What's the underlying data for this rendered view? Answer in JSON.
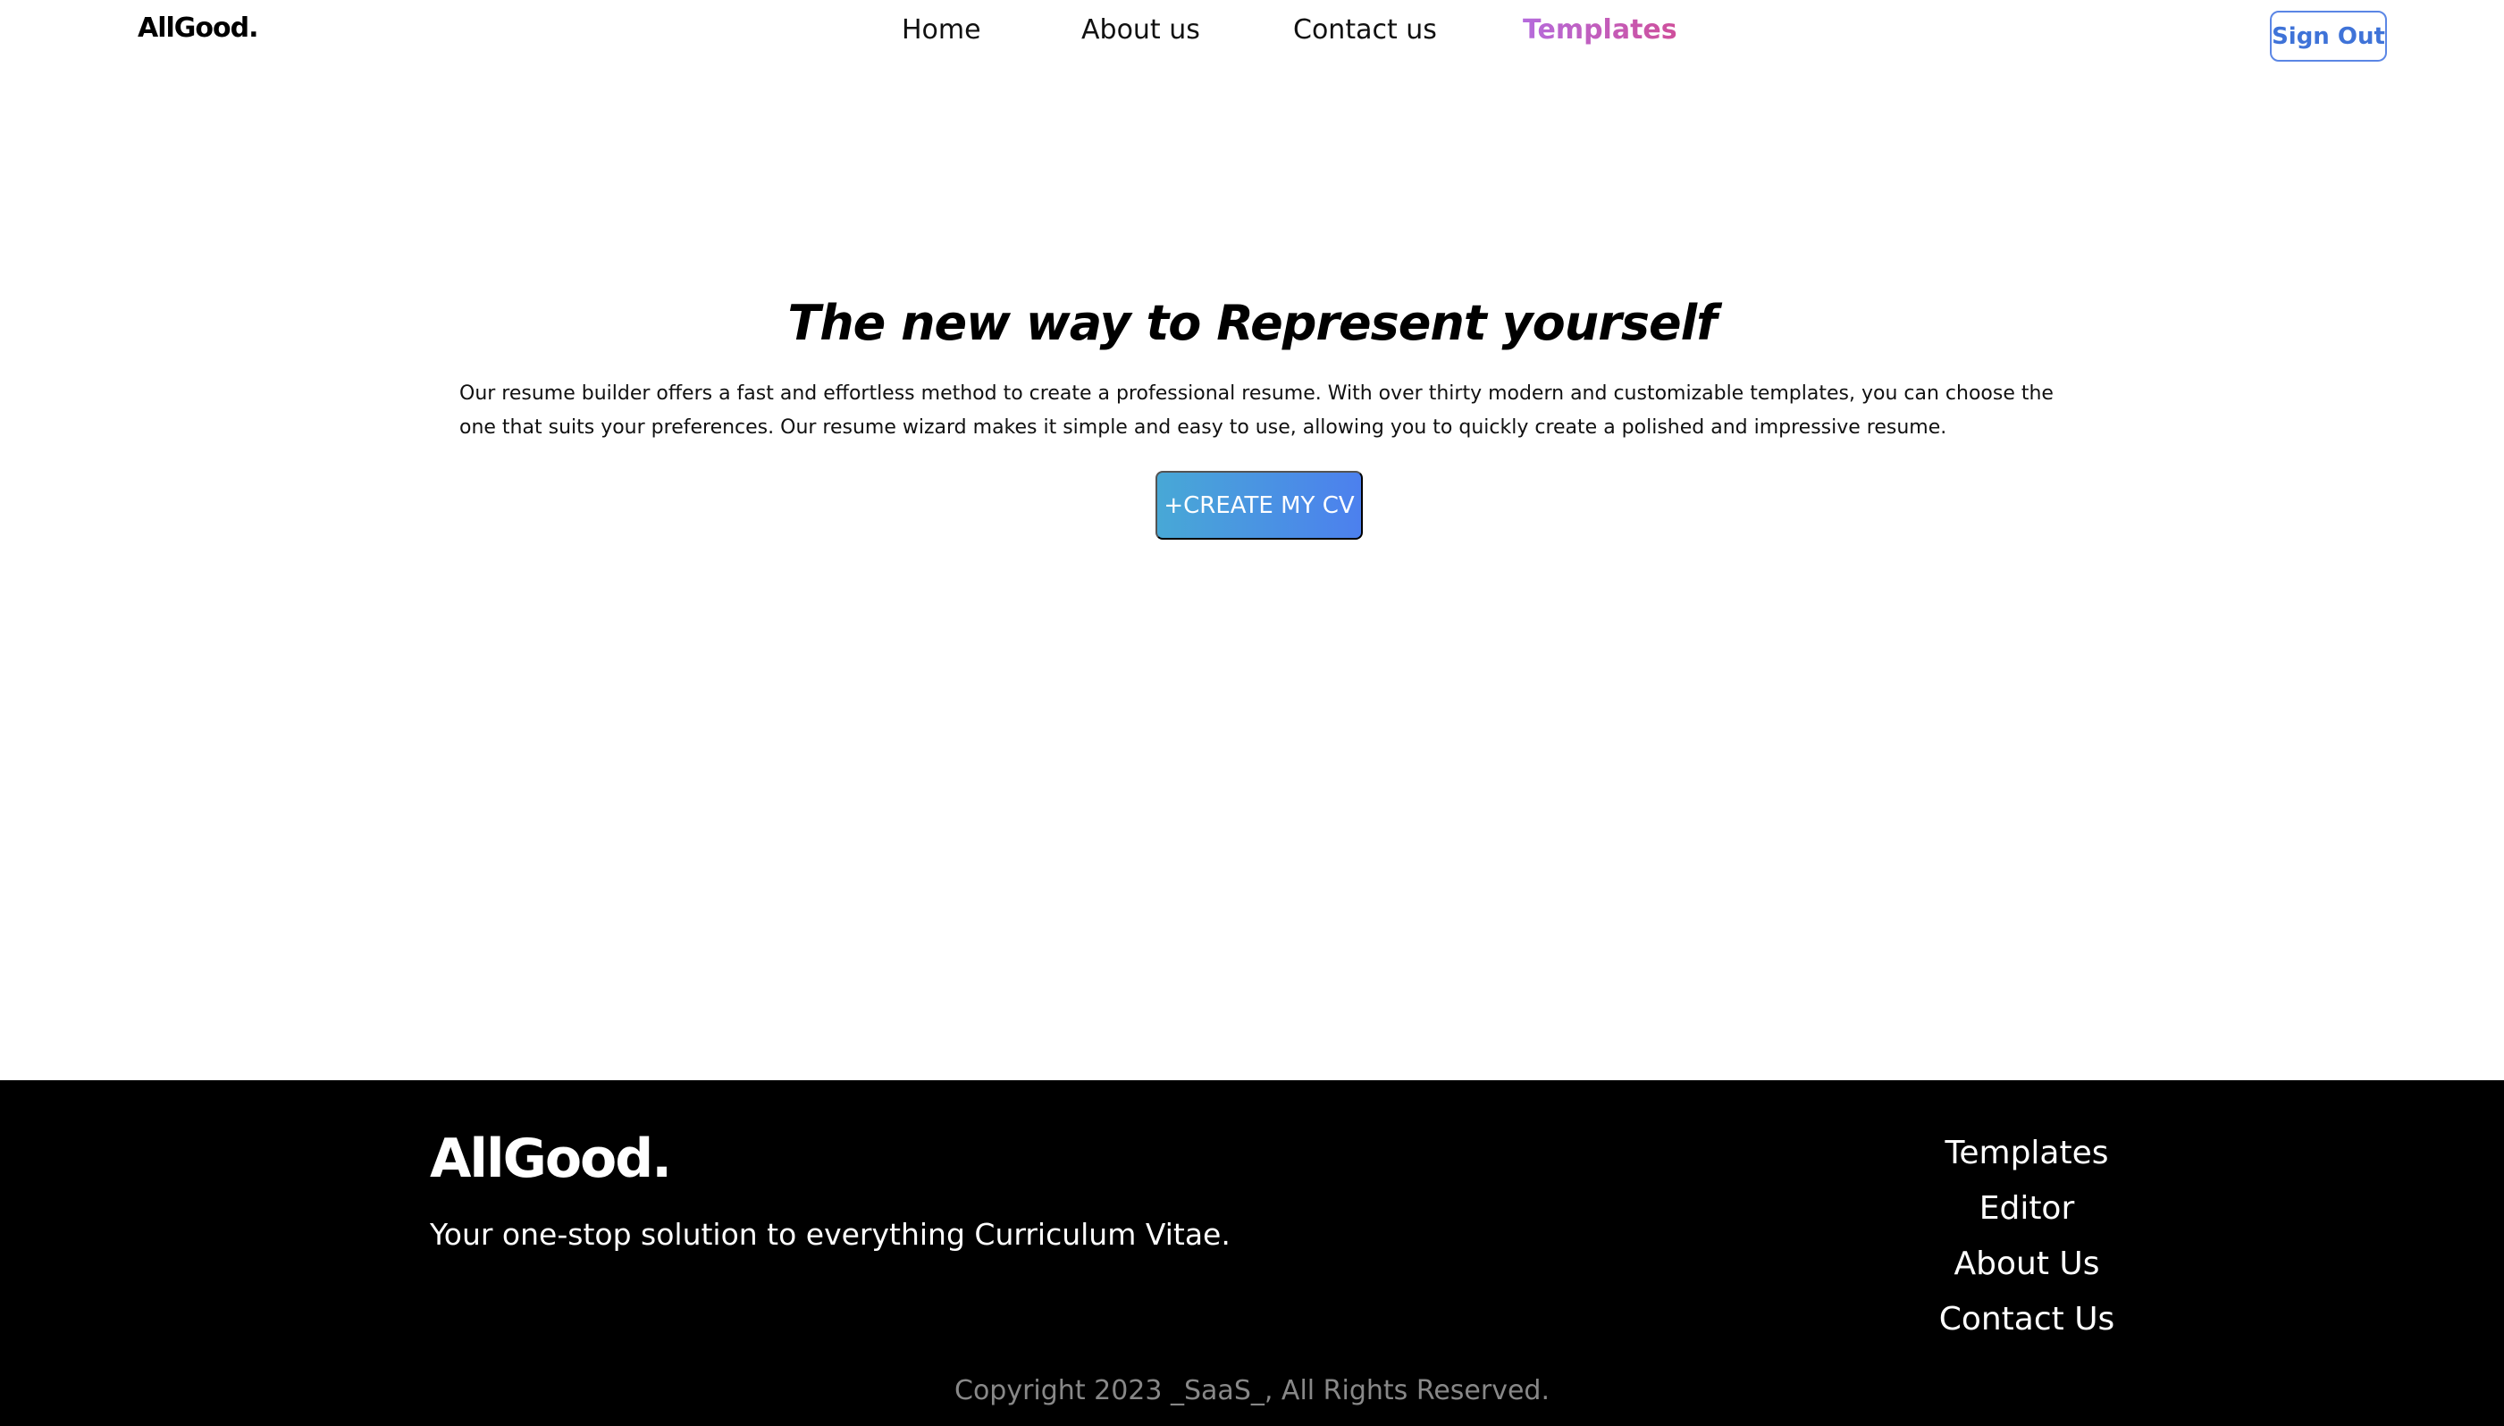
{
  "header": {
    "logo": "AllGood.",
    "nav": [
      {
        "label": "Home"
      },
      {
        "label": "About us"
      },
      {
        "label": "Contact us"
      },
      {
        "label": "Templates"
      }
    ],
    "signout_label": "Sign Out"
  },
  "hero": {
    "title": "The new way to Represent yourself",
    "description": "Our resume builder offers a fast and effortless method to create a professional resume. With over thirty modern and customizable templates, you can choose the one that suits your preferences. Our resume wizard makes it simple and easy to use, allowing you to quickly create a polished and impressive resume.",
    "cta_label": "+CREATE MY CV"
  },
  "footer": {
    "logo": "AllGood.",
    "tagline": "Your one-stop solution to everything Curriculum Vitae.",
    "links": [
      {
        "label": "Templates"
      },
      {
        "label": "Editor"
      },
      {
        "label": "About Us"
      },
      {
        "label": "Contact Us"
      }
    ],
    "copyright": "Copyright 2023 _SaaS_, All Rights Reserved."
  },
  "colors": {
    "active_nav_gradient": [
      "#b56bdc",
      "#cf4f9b"
    ],
    "cta_gradient": [
      "#48a8d6",
      "#4c80ee"
    ],
    "signout_border": "#5b86e5",
    "footer_bg": "#000000"
  }
}
